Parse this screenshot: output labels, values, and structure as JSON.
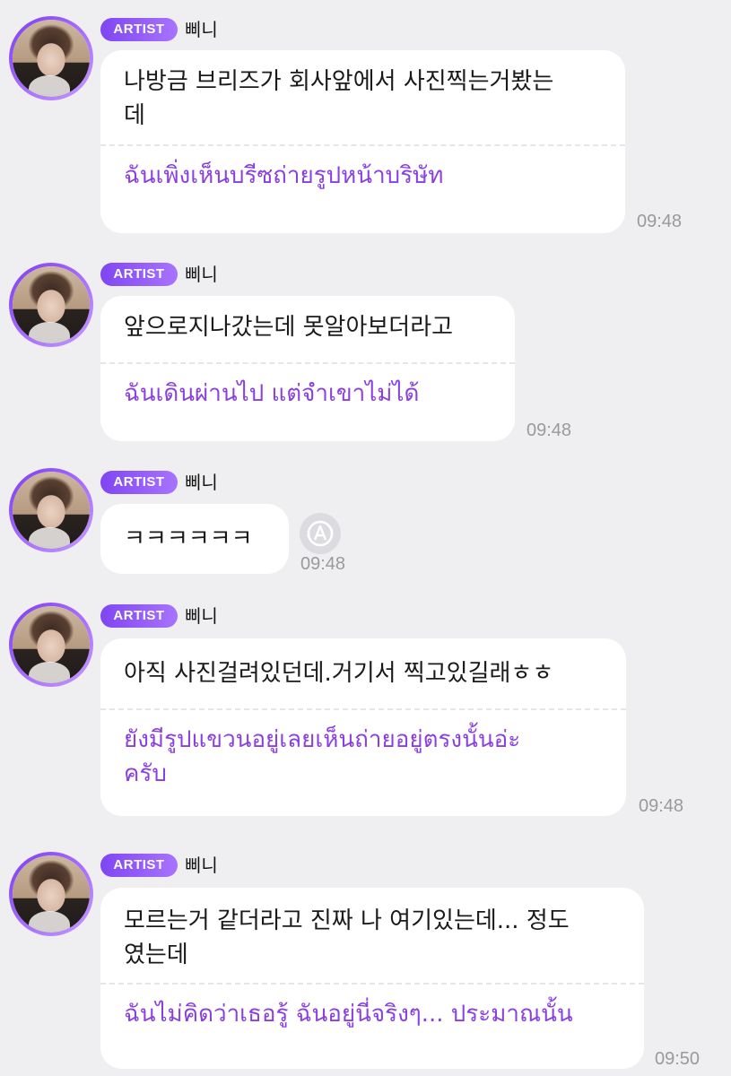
{
  "messages": [
    {
      "badge": "ARTIST",
      "name": "삐니",
      "original": "나방금 브리즈가 회사앞에서 사진찍는거봤는\n데",
      "translation": "ฉันเพิ่งเห็นบรีซถ่ายรูปหน้าบริษัท",
      "time": "09:48"
    },
    {
      "badge": "ARTIST",
      "name": "삐니",
      "original": "앞으로지나갔는데 못알아보더라고",
      "translation": "ฉันเดินผ่านไป แต่จำเขาไม่ได้",
      "time": "09:48"
    },
    {
      "badge": "ARTIST",
      "name": "삐니",
      "original": "ㅋㅋㅋㅋㅋㅋ",
      "translation": "",
      "time": "09:48",
      "translate_icon": "translate-icon"
    },
    {
      "badge": "ARTIST",
      "name": "삐니",
      "original": "아직 사진걸려있던데.거기서 찍고있길래ㅎㅎ",
      "translation": "ยังมีรูปแขวนอยู่เลยเห็นถ่ายอยู่ตรงนั้นอ่ะ\nครับ",
      "time": "09:48"
    },
    {
      "badge": "ARTIST",
      "name": "삐니",
      "original": "모르는거 같더라고 진짜 나 여기있는데... 정도\n였는데",
      "translation": "ฉันไม่คิดว่าเธอรู้ ฉันอยู่นี่จริงๆ... ประมาณนั้น",
      "time": "09:50"
    }
  ],
  "colors": {
    "background": "#efeff1",
    "badge": "#8a4df5",
    "translation_text": "#8a3fe0",
    "time_text": "#9a9a9e"
  }
}
